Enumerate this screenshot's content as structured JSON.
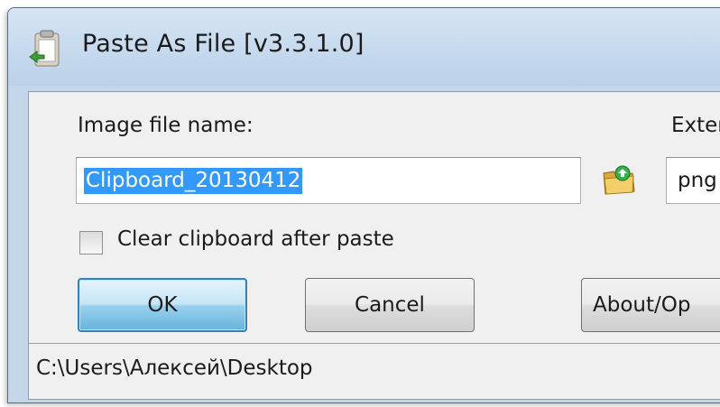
{
  "window": {
    "title": "Paste As File [v3.3.1.0]",
    "icon": "paste-as-file-app-icon"
  },
  "form": {
    "name_label": "Image file name:",
    "name_value": "Clipboard_20130412",
    "extension_label": "Exter",
    "extension_value": "png",
    "browse_icon": "folder-icon",
    "clear_clipboard_label": "Clear clipboard after paste",
    "clear_clipboard_checked": false
  },
  "buttons": {
    "ok": "OK",
    "cancel": "Cancel",
    "about": "About/Op"
  },
  "status": {
    "path": "C:\\Users\\Алексей\\Desktop"
  },
  "colors": {
    "selection": "#3399ff",
    "default_button_border": "#3c7fb1"
  }
}
